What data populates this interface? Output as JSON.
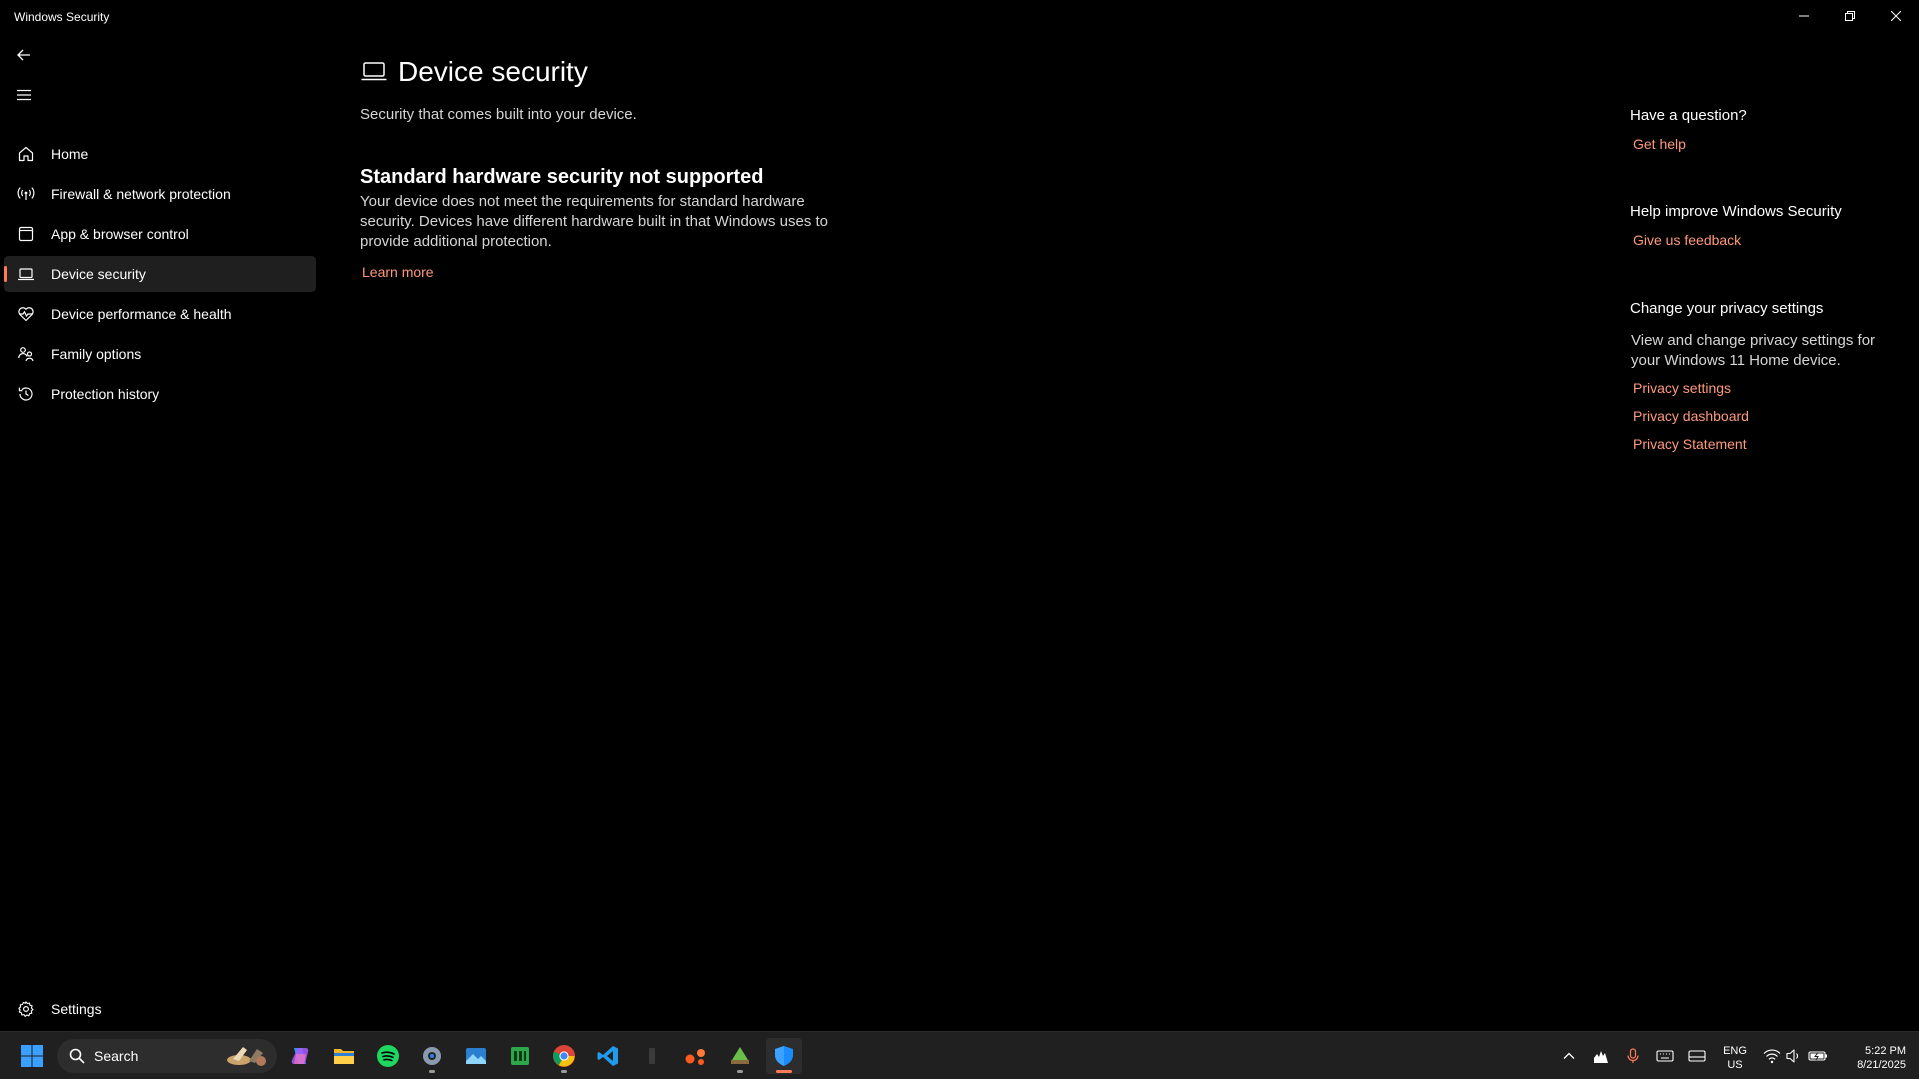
{
  "window": {
    "title": "Windows Security"
  },
  "sidebar": {
    "items": [
      {
        "label": "Home",
        "icon": "home-icon"
      },
      {
        "label": "Firewall & network protection",
        "icon": "wireless-signal-icon"
      },
      {
        "label": "App & browser control",
        "icon": "app-window-icon"
      },
      {
        "label": "Device security",
        "icon": "laptop-icon",
        "active": true
      },
      {
        "label": "Device performance & health",
        "icon": "heart-pulse-icon"
      },
      {
        "label": "Family options",
        "icon": "family-icon"
      },
      {
        "label": "Protection history",
        "icon": "history-icon"
      }
    ],
    "settings_label": "Settings"
  },
  "main": {
    "title": "Device security",
    "subtitle": "Security that comes built into your device.",
    "section_title": "Standard hardware security not supported",
    "section_body": "Your device does not meet the requirements for standard hardware security. Devices have different hardware built in that Windows uses to provide additional protection.",
    "learn_more": "Learn more"
  },
  "right": {
    "question_heading": "Have a question?",
    "get_help": "Get help",
    "improve_heading": "Help improve Windows Security",
    "feedback_link": "Give us feedback",
    "privacy_heading": "Change your privacy settings",
    "privacy_text": "View and change privacy settings for your Windows 11 Home device.",
    "privacy_settings": "Privacy settings",
    "privacy_dashboard": "Privacy dashboard",
    "privacy_statement": "Privacy Statement"
  },
  "taskbar": {
    "search_label": "Search",
    "apps": [
      "start",
      "search",
      "copilot",
      "file-explorer",
      "spotify",
      "settings",
      "photos",
      "terminal",
      "chrome",
      "vscode",
      "unknown-app",
      "app-orange",
      "app-green",
      "windows-security"
    ],
    "language_line1": "ENG",
    "language_line2": "US",
    "time": "5:22 PM",
    "date": "8/21/2025"
  },
  "colors": {
    "background": "#000000",
    "accent": "#ff7a59",
    "link": "#ff9a7a",
    "taskbar": "#202020"
  }
}
